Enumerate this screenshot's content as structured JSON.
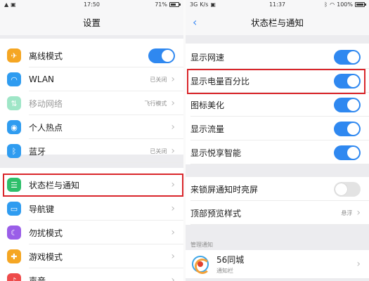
{
  "left": {
    "status": {
      "time": "17:50",
      "battery": "71%",
      "battery_fraction": 0.71
    },
    "title": "设置",
    "items": [
      {
        "label": "离线模式",
        "icon": "airplane-icon",
        "icon_color": "#f5a623",
        "toggle": true
      },
      {
        "label": "WLAN",
        "icon": "wifi-icon",
        "icon_color": "#2f9cf0",
        "value": "已关闭"
      },
      {
        "label": "移动网络",
        "icon": "mobile-network-icon",
        "icon_color": "#9fe6c7",
        "value": "飞行模式",
        "dim": true
      },
      {
        "label": "个人热点",
        "icon": "hotspot-icon",
        "icon_color": "#2f9cf0"
      },
      {
        "label": "蓝牙",
        "icon": "bluetooth-icon",
        "icon_color": "#2f9cf0",
        "value": "已关闭"
      },
      {
        "label": "状态栏与通知",
        "icon": "status-bar-icon",
        "icon_color": "#2dbf6a"
      },
      {
        "label": "导航键",
        "icon": "navigation-icon",
        "icon_color": "#2f9cf0"
      },
      {
        "label": "勿扰模式",
        "icon": "moon-icon",
        "icon_color": "#9a5ee8"
      },
      {
        "label": "游戏模式",
        "icon": "game-icon",
        "icon_color": "#f5a623"
      },
      {
        "label": "声音",
        "icon": "sound-icon",
        "icon_color": "#ee4b4b"
      }
    ]
  },
  "right": {
    "status": {
      "carrier": "3G",
      "time": "11:37",
      "battery": "100%",
      "battery_fraction": 1.0
    },
    "title": "状态栏与通知",
    "items": [
      {
        "label": "显示网速",
        "toggle": true
      },
      {
        "label": "显示电量百分比",
        "toggle": true
      },
      {
        "label": "图标美化",
        "toggle": true
      },
      {
        "label": "显示流量",
        "toggle": true
      },
      {
        "label": "显示悦享智能",
        "toggle": true
      }
    ],
    "items2": [
      {
        "label": "来锁屏通知时亮屏",
        "toggle": false
      },
      {
        "label": "顶部预览样式",
        "value": "悬浮"
      }
    ],
    "section_header": "管理通知",
    "apps": [
      {
        "name": "56同城",
        "sub": "通知栏"
      }
    ]
  },
  "colors": {
    "accent": "#2f88f0",
    "highlight": "#d9262b"
  }
}
